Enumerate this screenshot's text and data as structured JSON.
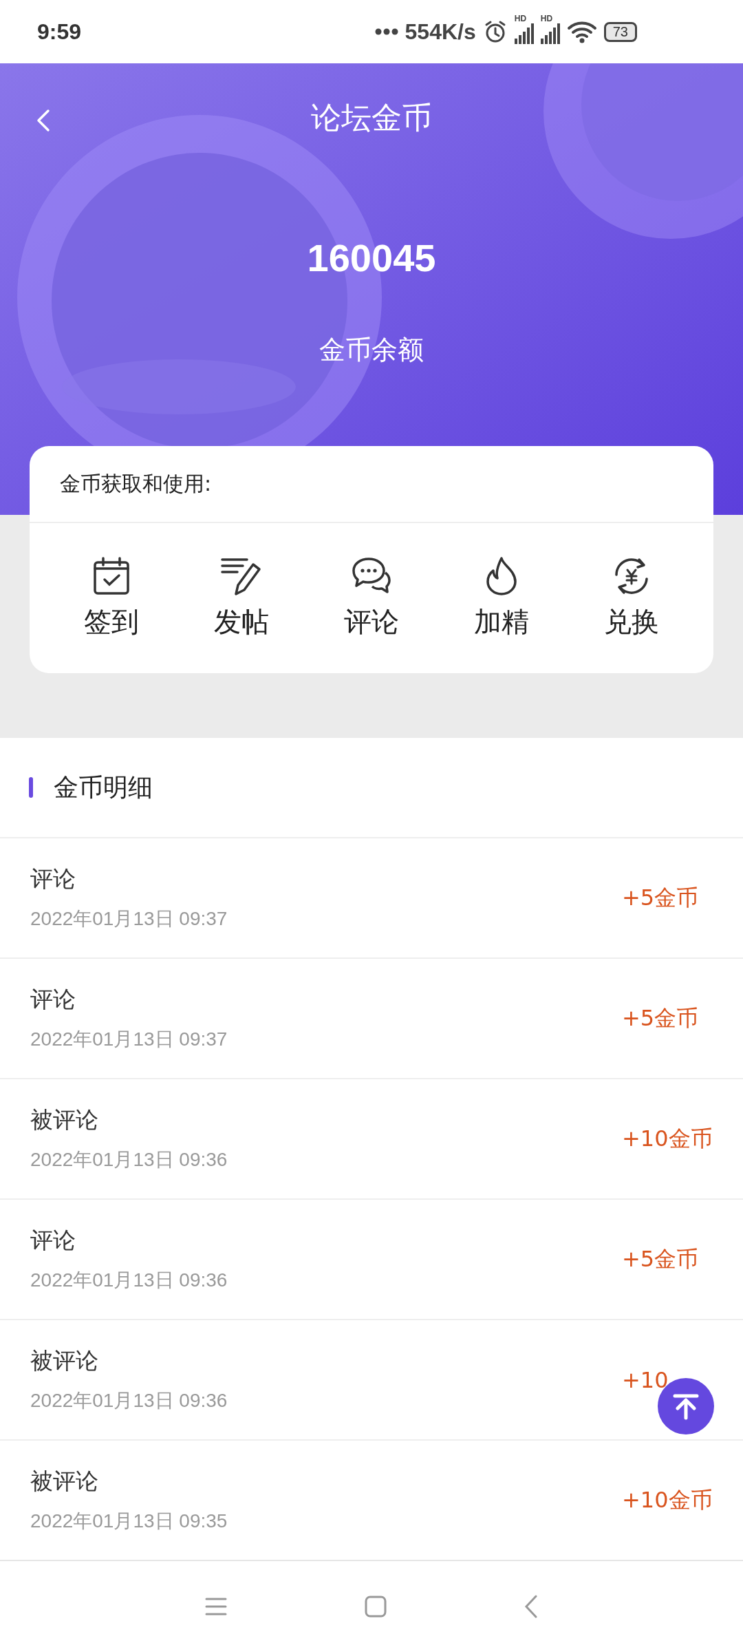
{
  "status_bar": {
    "time": "9:59",
    "net_speed": "554K/s",
    "signals": [
      {
        "label": "HD"
      },
      {
        "label": "HD"
      }
    ],
    "battery": "73"
  },
  "header": {
    "title": "论坛金币",
    "balance": "160045",
    "balance_label": "金币余额"
  },
  "earn_card": {
    "title": "金币获取和使用:",
    "actions": [
      {
        "kind": "checkin",
        "label": "签到"
      },
      {
        "kind": "post",
        "label": "发帖"
      },
      {
        "kind": "comment",
        "label": "评论"
      },
      {
        "kind": "feature",
        "label": "加精"
      },
      {
        "kind": "exchange",
        "label": "兑换"
      }
    ]
  },
  "history": {
    "title": "金币明细",
    "rows": [
      {
        "title": "评论",
        "time": "2022年01月13日 09:37",
        "amount": "+5金币"
      },
      {
        "title": "评论",
        "time": "2022年01月13日 09:37",
        "amount": "+5金币"
      },
      {
        "title": "被评论",
        "time": "2022年01月13日 09:36",
        "amount": "+10金币"
      },
      {
        "title": "评论",
        "time": "2022年01月13日 09:36",
        "amount": "+5金币"
      },
      {
        "title": "被评论",
        "time": "2022年01月13日 09:36",
        "amount": "+10"
      },
      {
        "title": "被评论",
        "time": "2022年01月13日 09:35",
        "amount": "+10金币"
      }
    ]
  }
}
